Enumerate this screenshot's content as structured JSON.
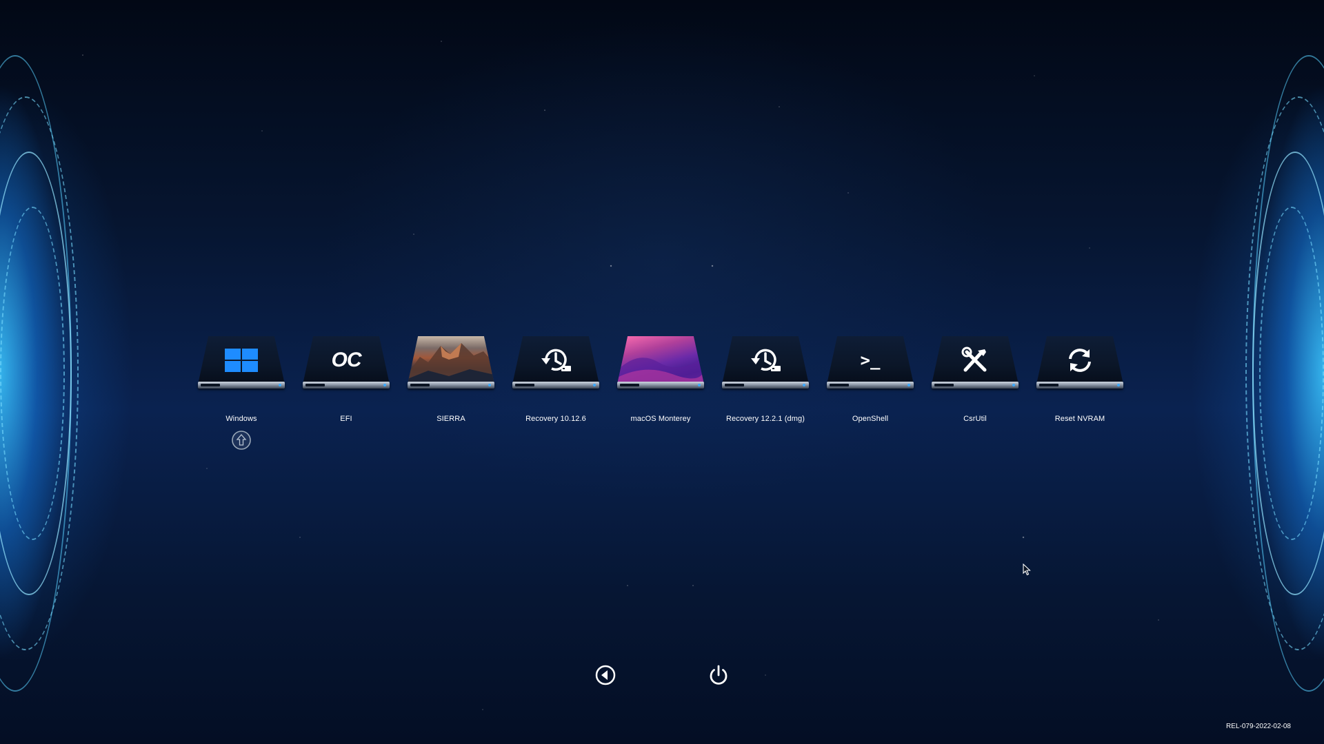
{
  "boot_picker": {
    "entries": [
      {
        "label": "Windows",
        "icon": "windows-logo-icon"
      },
      {
        "label": "EFI",
        "icon": "opencore-icon",
        "icon_text": "OC"
      },
      {
        "label": "SIERRA",
        "icon": "macos-sierra-wallpaper-icon"
      },
      {
        "label": "Recovery 10.12.6",
        "icon": "recovery-history-icon"
      },
      {
        "label": "macOS Monterey",
        "icon": "macos-monterey-wallpaper-icon"
      },
      {
        "label": "Recovery 12.2.1 (dmg)",
        "icon": "recovery-history-icon"
      },
      {
        "label": "OpenShell",
        "icon": "terminal-prompt-icon",
        "icon_text": ">_"
      },
      {
        "label": "CsrUtil",
        "icon": "tools-icon"
      },
      {
        "label": "Reset NVRAM",
        "icon": "refresh-icon"
      }
    ],
    "selected_index": 0,
    "selector_icon": "selection-arrow-icon"
  },
  "toolbar": {
    "left_button_icon": "back-arrow-icon",
    "right_button_icon": "power-icon"
  },
  "version": "REL-079-2022-02-08",
  "colors": {
    "background": "#061530",
    "accent_glow": "#3cc8ff",
    "windows_blue": "#1e8cff",
    "label_text": "#ffffff"
  }
}
